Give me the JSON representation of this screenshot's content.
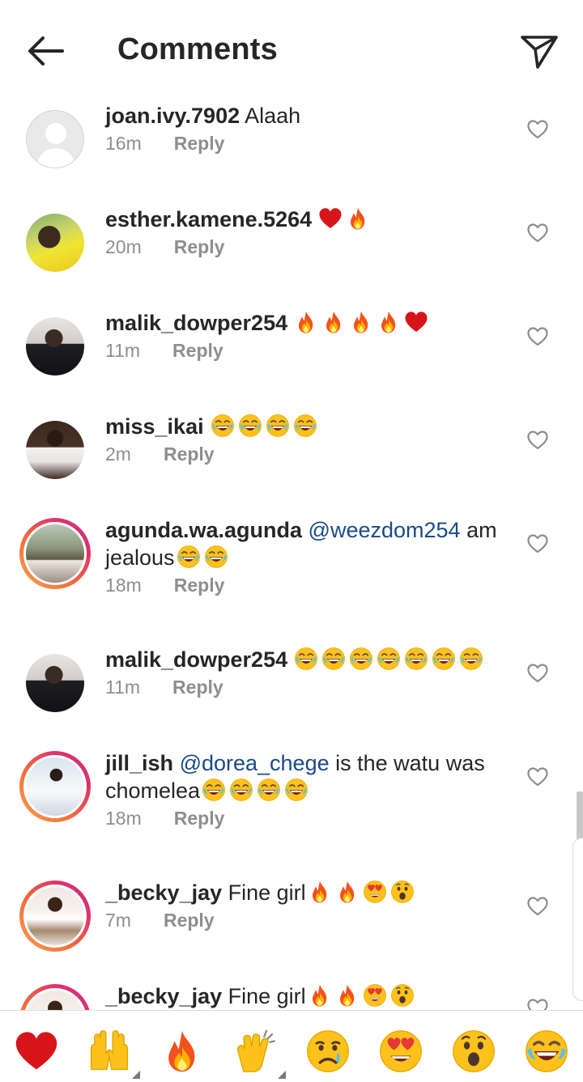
{
  "header": {
    "title": "Comments",
    "back_icon": "arrow-left-icon",
    "share_icon": "paper-plane-icon"
  },
  "comments": [
    {
      "user": "joan.ivy.7902",
      "text": "Alaah",
      "emojis": [],
      "time": "16m",
      "reply": "Reply",
      "avatar": "default-avatar"
    },
    {
      "user": "esther.kamene.5264",
      "text": "",
      "emojis": [
        "heart",
        "fire"
      ],
      "time": "20m",
      "reply": "Reply",
      "avatar": "yellow-shirt"
    },
    {
      "user": "malik_dowper254",
      "text": "",
      "emojis": [
        "fire",
        "fire",
        "fire",
        "fire",
        "heart"
      ],
      "time": "11m",
      "reply": "Reply",
      "avatar": "suit"
    },
    {
      "user": "miss_ikai",
      "text": "",
      "emojis": [
        "laugh",
        "laugh",
        "laugh",
        "laugh"
      ],
      "time": "2m",
      "reply": "Reply",
      "avatar": "girl-white"
    },
    {
      "user": "agunda.wa.agunda",
      "mention": "@weezdom254",
      "text": "am jealous",
      "emojis": [
        "laugh",
        "laugh"
      ],
      "time": "18m",
      "reply": "Reply",
      "avatar": "group"
    },
    {
      "user": "malik_dowper254",
      "text": "",
      "emojis": [
        "laugh",
        "laugh",
        "laugh",
        "laugh",
        "laugh",
        "laugh",
        "laugh"
      ],
      "time": "11m",
      "reply": "Reply",
      "avatar": "suit"
    },
    {
      "user": "jill_ish",
      "mention": "@dorea_chege",
      "text": "is the watu was chomelea",
      "emojis": [
        "laugh",
        "laugh",
        "laugh",
        "laugh"
      ],
      "time": "18m",
      "reply": "Reply",
      "avatar": "fila"
    },
    {
      "user": "_becky_jay",
      "text": "Fine girl",
      "emojis": [
        "fire",
        "fire",
        "heart-eyes",
        "surprised"
      ],
      "time": "7m",
      "reply": "Reply",
      "avatar": "becky"
    },
    {
      "user": "_becky_jay",
      "text": "Fine girl",
      "emojis": [
        "fire",
        "fire",
        "heart-eyes",
        "surprised"
      ],
      "time": "",
      "reply": "",
      "avatar": "becky"
    }
  ],
  "like_icon": "heart-outline-icon",
  "quick_emojis": [
    "heart",
    "raised-hands",
    "fire",
    "clapping-hands",
    "crying",
    "heart-eyes",
    "surprised",
    "laugh"
  ]
}
